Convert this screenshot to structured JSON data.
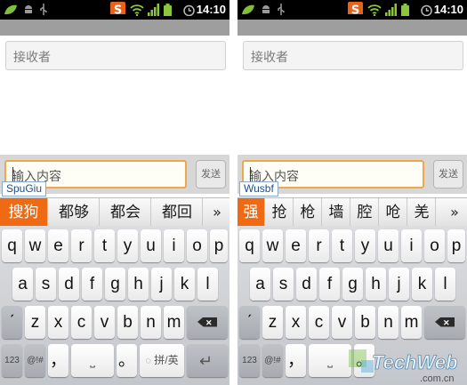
{
  "screens": [
    {
      "id": "left",
      "status": {
        "time": "14:10"
      },
      "recipient_placeholder": "接收者",
      "message_placeholder": "输入内容",
      "send_label": "发送",
      "pinyin": "SpuGiu",
      "candidates": [
        "搜狗",
        "都够",
        "都会",
        "都回"
      ],
      "candidate_more": "»",
      "keys": {
        "row1": [
          "q",
          "w",
          "e",
          "r",
          "t",
          "y",
          "u",
          "i",
          "o",
          "p"
        ],
        "row2": [
          "a",
          "s",
          "d",
          "f",
          "g",
          "h",
          "j",
          "k",
          "l"
        ],
        "row3_left": "ˊ",
        "row3": [
          "z",
          "x",
          "c",
          "v",
          "b",
          "n",
          "m"
        ],
        "row4": {
          "num": "123",
          "sym": "@!#",
          "comma": "，",
          "space": "⎵",
          "period": "。",
          "lang": "拼/英",
          "enter": "↵"
        }
      }
    },
    {
      "id": "right",
      "status": {
        "time": "14:10"
      },
      "recipient_placeholder": "接收者",
      "message_placeholder": "输入内容",
      "send_label": "发送",
      "pinyin": "Wusbf",
      "candidates": [
        "强",
        "抢",
        "枪",
        "墙",
        "腔",
        "呛",
        "羌"
      ],
      "candidate_more": "»",
      "keys": {
        "row1": [
          "q",
          "w",
          "e",
          "r",
          "t",
          "y",
          "u",
          "i",
          "o",
          "p"
        ],
        "row2": [
          "a",
          "s",
          "d",
          "f",
          "g",
          "h",
          "j",
          "k",
          "l"
        ],
        "row3_left": "ˊ",
        "row3": [
          "z",
          "x",
          "c",
          "v",
          "b",
          "n",
          "m"
        ],
        "row4": {
          "num": "123",
          "sym": "@!#",
          "comma": "，",
          "space": "⎵",
          "period": "。"
        }
      }
    }
  ],
  "watermark": {
    "text": "TechWeb",
    "sub": ".com.cn"
  },
  "colors": {
    "candidate_selected": "#f06a14",
    "input_border": "#f0a64a",
    "status_bar": "#000000"
  }
}
